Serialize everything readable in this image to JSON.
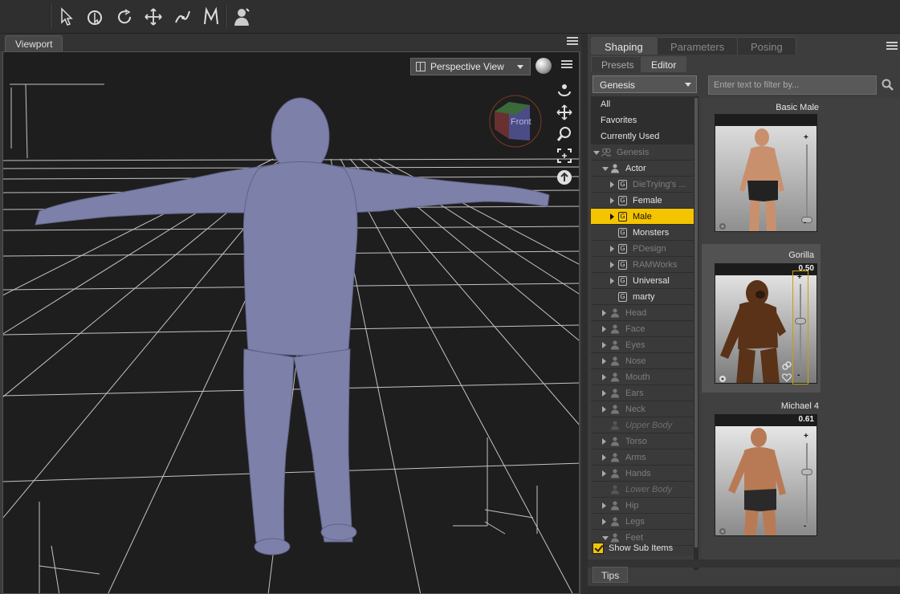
{
  "toolbar": {
    "tools": [
      "select-tool-icon",
      "node-select-icon",
      "rotate-icon",
      "translate-icon",
      "joint-editor-icon",
      "morph-icon",
      "figure-icon"
    ]
  },
  "viewport": {
    "tab_label": "Viewport",
    "camera_select": "Perspective View",
    "cube_label": "Front"
  },
  "panel": {
    "tabs": [
      "Shaping",
      "Parameters",
      "Posing"
    ],
    "active_tab": "Shaping",
    "subtabs": [
      "Presets",
      "Editor"
    ],
    "active_subtab": "Editor",
    "figure_select": "Genesis",
    "filter_placeholder": "Enter text to filter by...",
    "show_sub_items": "Show Sub Items",
    "tips_tab": "Tips"
  },
  "categories": {
    "top": [
      "All",
      "Favorites",
      "Currently Used"
    ],
    "genesis": "Genesis",
    "actor": "Actor",
    "actor_children": [
      {
        "label": "DieTrying's ...",
        "dim": true,
        "expandable": true
      },
      {
        "label": "Female",
        "dim": false,
        "expandable": true
      },
      {
        "label": "Male",
        "dim": false,
        "expandable": true,
        "selected": true
      },
      {
        "label": "Monsters",
        "dim": false,
        "expandable": false
      },
      {
        "label": "PDesign",
        "dim": true,
        "expandable": true
      },
      {
        "label": "RAMWorks",
        "dim": true,
        "expandable": true
      },
      {
        "label": "Universal",
        "dim": false,
        "expandable": true
      },
      {
        "label": "marty",
        "dim": false,
        "expandable": false
      }
    ],
    "body_parts": [
      {
        "label": "Head",
        "italic": false
      },
      {
        "label": "Face",
        "italic": false
      },
      {
        "label": "Eyes",
        "italic": false
      },
      {
        "label": "Nose",
        "italic": false
      },
      {
        "label": "Mouth",
        "italic": false
      },
      {
        "label": "Ears",
        "italic": false
      },
      {
        "label": "Neck",
        "italic": false
      },
      {
        "label": "Upper Body",
        "italic": true
      },
      {
        "label": "Torso",
        "italic": false
      },
      {
        "label": "Arms",
        "italic": false
      },
      {
        "label": "Hands",
        "italic": false
      },
      {
        "label": "Lower Body",
        "italic": true
      },
      {
        "label": "Hip",
        "italic": false
      },
      {
        "label": "Legs",
        "italic": false
      },
      {
        "label": "Feet",
        "italic": false
      }
    ]
  },
  "morphs": [
    {
      "name": "Basic Male",
      "value": "",
      "level": 0.0
    },
    {
      "name": "Gorilla",
      "value": "0.50",
      "level": 0.5
    },
    {
      "name": "Michael 4",
      "value": "0.61",
      "level": 0.61
    }
  ],
  "colors": {
    "accent": "#f5c400",
    "figure": "#7d80a8",
    "grid": "#d0d0d0"
  }
}
